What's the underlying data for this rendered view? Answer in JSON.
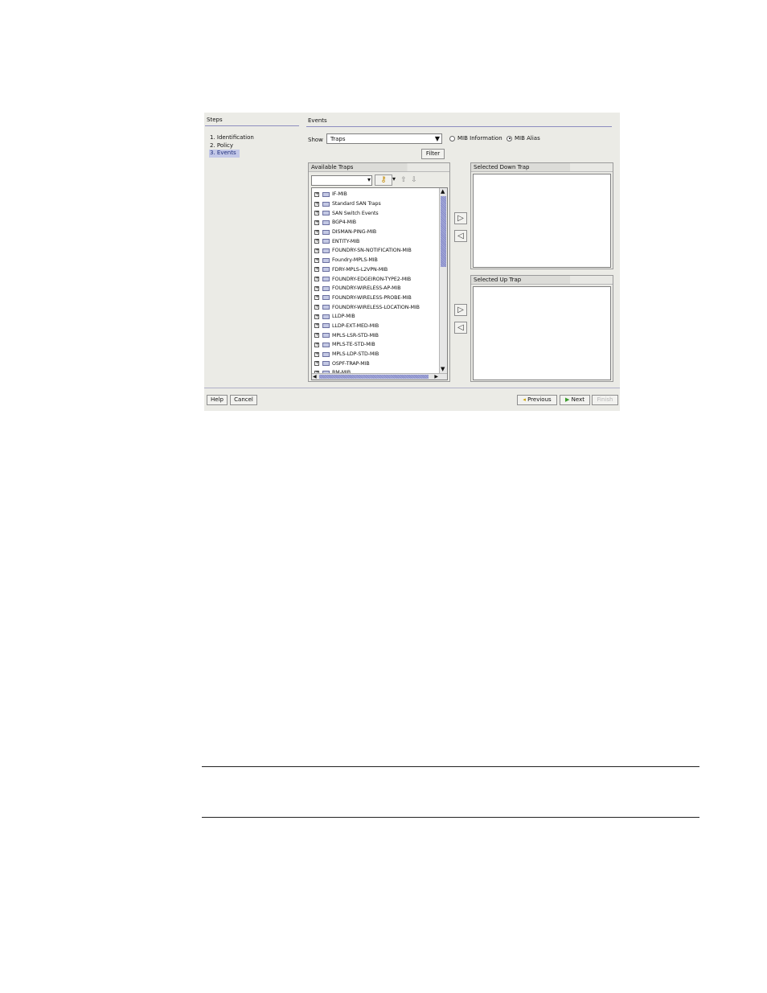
{
  "steps": {
    "title": "Steps",
    "items": [
      {
        "label": "1. Identification",
        "active": false
      },
      {
        "label": "2. Policy",
        "active": false
      },
      {
        "label": "3. Events",
        "active": true
      }
    ]
  },
  "events": {
    "title": "Events",
    "show_label": "Show",
    "show_value": "Traps",
    "radio_mib_information": "MIB Information",
    "radio_mib_alias": "MIB Alias",
    "selected_radio": "MIB Alias",
    "filter_button": "Filter"
  },
  "available_traps": {
    "header": "Available Traps",
    "items": [
      "IF-MIB",
      "Standard SAN Traps",
      "SAN Switch Events",
      "BGP4-MIB",
      "DISMAN-PING-MIB",
      "ENTITY-MIB",
      "FOUNDRY-SN-NOTIFICATION-MIB",
      "Foundry-MPLS-MIB",
      "FDRY-MPLS-L2VPN-MIB",
      "FOUNDRY-EDGEIRON-TYPE2-MIB",
      "FOUNDRY-WIRELESS-AP-MIB",
      "FOUNDRY-WIRELESS-PROBE-MIB",
      "FOUNDRY-WIRELESS-LOCATION-MIB",
      "LLDP-MIB",
      "LLDP-EXT-MED-MIB",
      "MPLS-LSR-STD-MIB",
      "MPLS-TE-STD-MIB",
      "MPLS-LDP-STD-MIB",
      "OSPF-TRAP-MIB",
      "RM-MIB"
    ]
  },
  "selected_down_trap": {
    "header": "Selected Down Trap"
  },
  "selected_up_trap": {
    "header": "Selected Up Trap"
  },
  "footer": {
    "help": "Help",
    "cancel": "Cancel",
    "previous": "Previous",
    "next": "Next",
    "finish": "Finish"
  },
  "colors": {
    "dialog_bg": "#ebebe6",
    "accent_rule": "#8d8dbf",
    "selection": "#c3c8e8"
  }
}
